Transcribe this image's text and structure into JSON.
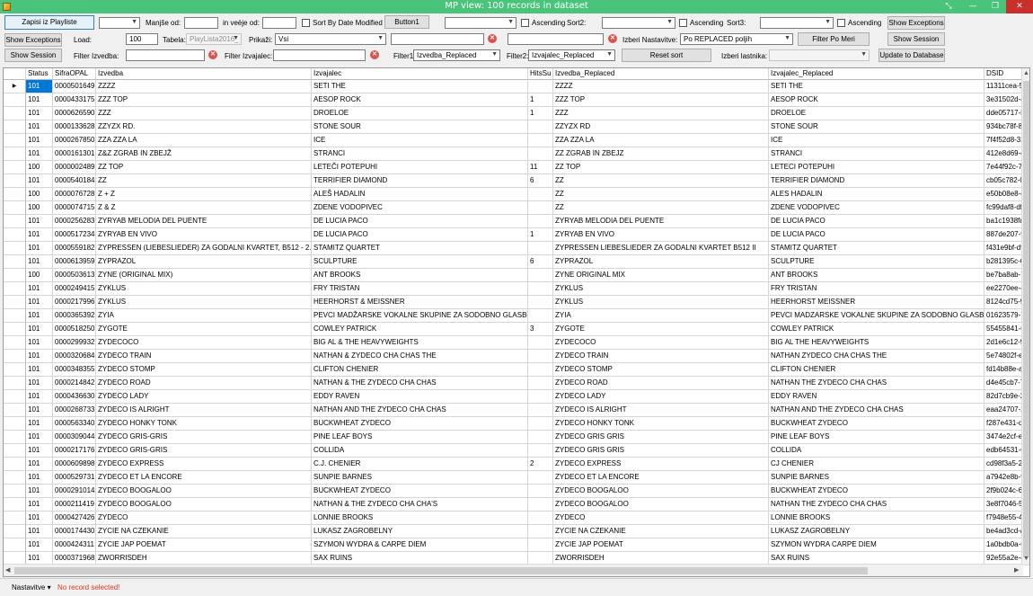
{
  "window": {
    "title": "MP view: 100 records in dataset",
    "restore": "⤡",
    "minimize": "—",
    "maximize": "❐",
    "close": "✕"
  },
  "toolbar": {
    "row1": {
      "write_playlist": "Zapisi iz Playliste",
      "less_than_label": "Manjše od:",
      "greater_than_label": "in veèje od:",
      "sort_by_date": "Sort By Date Modified",
      "button1": "Button1",
      "ascending1": "Ascending",
      "sort2": "Sort2:",
      "ascending2": "Ascending",
      "sort3": "Sort3:",
      "ascending3": "Ascending",
      "show_exceptions_right": "Show Exceptions"
    },
    "row2": {
      "show_exceptions": "Show Exceptions",
      "load_label": "Load:",
      "load_value": "100",
      "tabela_label": "Tabela:",
      "tabela_value": "PlayLista2016_",
      "prikazi_label": "Prikaži:",
      "prikazi_value": "Vsi",
      "izberi_nast_label": "Izberi Nastavitve:",
      "izberi_nast_value": "Po REPLACED poljih",
      "filter_po_meri": "Filter Po Meri",
      "show_session_right": "Show Session"
    },
    "row3": {
      "show_session": "Show Session",
      "filter_izvedba_label": "Filter Izvedba:",
      "filter_izvajalec_label": "Filter Izvajalec:",
      "filter1_label": "Filter1:",
      "filter1_value": "Izvedba_Replaced",
      "filter2_label": "Filter2:",
      "filter2_value": "Izvajalec_Replaced",
      "reset_sort": "Reset sort",
      "izberi_lastnika": "Izberi lastnika:",
      "update_db": "Update to Database"
    }
  },
  "grid": {
    "columns": [
      "Status",
      "SifraOPAL",
      "Izvedba",
      "Izvajalec",
      "HitsSu",
      "Izvedba_Replaced",
      "Izvajalec_Replaced",
      "DSID"
    ],
    "rows": [
      [
        "101",
        "0000501649",
        "ZZZZ",
        "SETI THE",
        "",
        "ZZZZ",
        "SETI THE",
        "11311cea-563"
      ],
      [
        "101",
        "0000433175",
        "ZZZ TOP",
        "AESOP ROCK",
        "1",
        "ZZZ TOP",
        "AESOP ROCK",
        "3e31502d-408"
      ],
      [
        "101",
        "0000626590",
        "ZZZ",
        "DROELOE",
        "1",
        "ZZZ",
        "DROELOE",
        "dde05717-be5"
      ],
      [
        "101",
        "0000133628",
        "ZZYZX RD.",
        "STONE SOUR",
        "",
        "ZZYZX RD",
        "STONE SOUR",
        "934bc78f-8e4"
      ],
      [
        "101",
        "0000267850",
        "ZZA ZZA LA",
        "ICE",
        "",
        "ZZA ZZA LA",
        "ICE",
        "7f4f52d8-3299"
      ],
      [
        "101",
        "0000161301",
        "Z&Z ZGRAB IN ZBEJŽ",
        "STRANCI",
        "",
        "ZZ ZGRAB IN ZBEJZ",
        "STRANCI",
        "412e8d69-c6c"
      ],
      [
        "100",
        "0000002489",
        "ZZ TOP",
        "LETEČI POTEPUHI",
        "11",
        "ZZ TOP",
        "LETECI POTEPUHI",
        "7e44f92c-720"
      ],
      [
        "101",
        "0000540184",
        "ZZ",
        "TERRIFIER DIAMOND",
        "6",
        "ZZ",
        "TERRIFIER DIAMOND",
        "cb05c782-0eb"
      ],
      [
        "100",
        "0000076728",
        "Z + Z",
        "ALEŠ HADALIN",
        "",
        "ZZ",
        "ALES HADALIN",
        "e50b08e8-ea4"
      ],
      [
        "100",
        "0000074715",
        "Z & Z",
        "ZDENE VODOPIVEC",
        "",
        "ZZ",
        "ZDENE VODOPIVEC",
        "fc99daf8-df4e"
      ],
      [
        "101",
        "0000256283",
        "ZYRYAB MELODIA DEL PUENTE",
        "DE LUCIA PACO",
        "",
        "ZYRYAB MELODIA DEL PUENTE",
        "DE LUCIA PACO",
        "ba1c1938fd4"
      ],
      [
        "101",
        "0000517234",
        "ZYRYAB EN VIVO",
        "DE LUCIA PACO",
        "1",
        "ZYRYAB EN VIVO",
        "DE LUCIA PACO",
        "887de207-973"
      ],
      [
        "101",
        "0000559182",
        "ZYPRESSEN (LIEBESLIEDER) ZA GODALNI KVARTET, B512 - 2. II",
        "STAMITZ QUARTET",
        "",
        "ZYPRESSEN LIEBESLIEDER ZA GODALNI KVARTET B512 II",
        "STAMITZ QUARTET",
        "f431e9bf-d9fa"
      ],
      [
        "101",
        "0000613959",
        "ZYPRAZOL",
        "SCULPTURE",
        "6",
        "ZYPRAZOL",
        "SCULPTURE",
        "b281395c-6b7"
      ],
      [
        "100",
        "0000503613",
        "ZYNE (ORIGINAL MIX)",
        "ANT BROOKS",
        "",
        "ZYNE ORIGINAL MIX",
        "ANT BROOKS",
        "be7ba8ab-763"
      ],
      [
        "101",
        "0000249415",
        "ZYKLUS",
        "FRY TRISTAN",
        "",
        "ZYKLUS",
        "FRY TRISTAN",
        "ee2270ee-444"
      ],
      [
        "101",
        "0000217996",
        "ZYKLUS",
        "HEERHORST & MEISSNER",
        "",
        "ZYKLUS",
        "HEERHORST MEISSNER",
        "8124cd75-905"
      ],
      [
        "101",
        "0000365392",
        "ZYIA",
        "PEVCI MADŽARSKE VOKALNE SKUPINE ZA SODOBNO GLASBO F...",
        "",
        "ZYIA",
        "PEVCI MADZARSKE VOKALNE SKUPINE ZA SODOBNO GLASBO F",
        "01623579-725"
      ],
      [
        "101",
        "0000518250",
        "ZYGOTE",
        "COWLEY PATRICK",
        "3",
        "ZYGOTE",
        "COWLEY PATRICK",
        "55455841-616"
      ],
      [
        "101",
        "0000299932",
        "ZYDECOCO",
        "BIG AL & THE HEAVYWEIGHTS",
        "",
        "ZYDECOCO",
        "BIG AL THE HEAVYWEIGHTS",
        "2d1e6c12-9db"
      ],
      [
        "101",
        "0000320684",
        "ZYDECO TRAIN",
        "NATHAN & ZYDECO CHA CHAS THE",
        "",
        "ZYDECO TRAIN",
        "NATHAN ZYDECO CHA CHAS THE",
        "5e74802f-e1d"
      ],
      [
        "101",
        "0000348355",
        "ZYDECO STOMP",
        "CLIFTON CHENIER",
        "",
        "ZYDECO STOMP",
        "CLIFTON CHENIER",
        "fd14b88e-a314"
      ],
      [
        "101",
        "0000214842",
        "ZYDECO ROAD",
        "NATHAN & THE ZYDECO CHA CHAS",
        "",
        "ZYDECO ROAD",
        "NATHAN THE ZYDECO CHA CHAS",
        "d4e45cb7-753"
      ],
      [
        "101",
        "0000436630",
        "ZYDECO LADY",
        "EDDY RAVEN",
        "",
        "ZYDECO LADY",
        "EDDY RAVEN",
        "82d7cb9e-245"
      ],
      [
        "101",
        "0000268733",
        "ZYDECO IS ALRIGHT",
        "NATHAN AND THE ZYDECO CHA CHAS",
        "",
        "ZYDECO IS ALRIGHT",
        "NATHAN AND THE ZYDECO CHA CHAS",
        "eaa24707-2fa"
      ],
      [
        "101",
        "0000563340",
        "ZYDECO HONKY TONK",
        "BUCKWHEAT ZYDECO",
        "",
        "ZYDECO HONKY TONK",
        "BUCKWHEAT ZYDECO",
        "f287e431-d9f6"
      ],
      [
        "101",
        "0000309044",
        "ZYDECO GRIS-GRIS",
        "PINE LEAF BOYS",
        "",
        "ZYDECO GRIS GRIS",
        "PINE LEAF BOYS",
        "3474e2cf-edf2"
      ],
      [
        "101",
        "0000217176",
        "ZYDECO GRIS-GRIS",
        "COLLIDA",
        "",
        "ZYDECO GRIS GRIS",
        "COLLIDA",
        "edb64531-658"
      ],
      [
        "101",
        "0000609898",
        "ZYDECO EXPRESS",
        "C.J. CHENIER",
        "2",
        "ZYDECO EXPRESS",
        "CJ CHENIER",
        "cd98f3a5-2cbf"
      ],
      [
        "101",
        "0000529731",
        "ZYDECO ET LA ENCORE",
        "SUNPIE BARNES",
        "",
        "ZYDECO ET LA ENCORE",
        "SUNPIE BARNES",
        "a7942e8b-942"
      ],
      [
        "101",
        "0000291014",
        "ZYDECO BOOGALOO",
        "BUCKWHEAT ZYDECO",
        "",
        "ZYDECO BOOGALOO",
        "BUCKWHEAT ZYDECO",
        "2f9b024c-62e"
      ],
      [
        "101",
        "0000211419",
        "ZYDECO BOOGALOO",
        "NATHAN & THE ZYDECO CHA CHA'S",
        "",
        "ZYDECO BOOGALOO",
        "NATHAN THE ZYDECO CHA CHAS",
        "3e8f7046-500"
      ],
      [
        "101",
        "0000427426",
        "ZYDECO",
        "LONNIE BROOKS",
        "",
        "ZYDECO",
        "LONNIE BROOKS",
        "f7948e55-4e2"
      ],
      [
        "101",
        "0000174430",
        "ZYCIE NA CZEKANIE",
        "LUKASZ ZAGROBELNY",
        "",
        "ZYCIE NA CZEKANIE",
        "LUKASZ ZAGROBELNY",
        "be4ad3cd-a0c"
      ],
      [
        "101",
        "0000424311",
        "ZYCIE JAP POEMAT",
        "SZYMON WYDRA & CARPE DIEM",
        "",
        "ZYCIE JAP POEMAT",
        "SZYMON WYDRA CARPE DIEM",
        "1a0bdb0a-639"
      ],
      [
        "101",
        "0000371968",
        "ZWORRISDEH",
        "SAX RUINS",
        "",
        "ZWORRISDEH",
        "SAX RUINS",
        "92e55a2e-ed5"
      ]
    ]
  },
  "status": {
    "nastavitve": "Nastavitve",
    "no_record": "No record selected!"
  }
}
